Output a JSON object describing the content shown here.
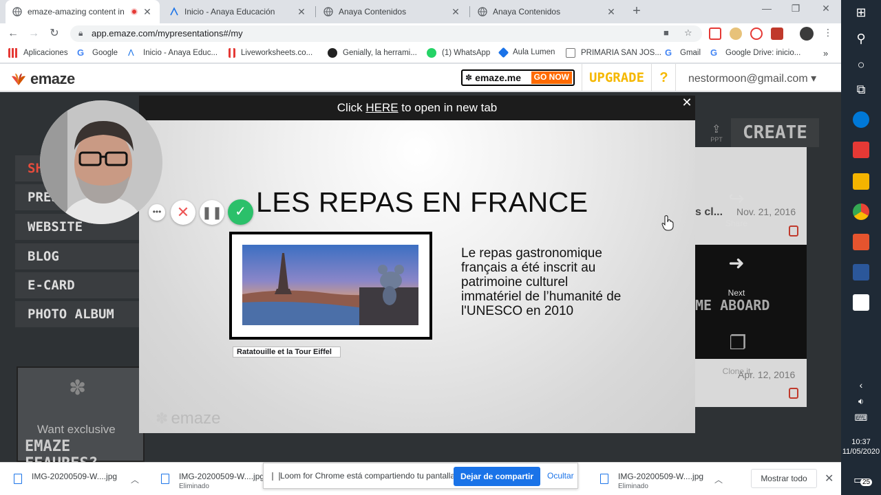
{
  "browser": {
    "tabs": [
      {
        "title": "emaze-amazing content in n",
        "active": true,
        "recording": true
      },
      {
        "title": "Inicio - Anaya Educación"
      },
      {
        "title": "Anaya Contenidos"
      },
      {
        "title": "Anaya Contenidos"
      }
    ],
    "url": "app.emaze.com/mypresentations#/my",
    "bookmarks": [
      "Aplicaciones",
      "Google",
      "Inicio - Anaya Educ...",
      "Liveworksheets.co...",
      "Genially, la herrami...",
      "(1) WhatsApp",
      "Aula Lumen",
      "PRIMARIA SAN JOS...",
      "Gmail",
      "Google Drive: inicio..."
    ]
  },
  "emaze": {
    "logo": "emaze",
    "emazeme_brand": "emaze.me",
    "go_now": "GO NOW",
    "upgrade": "UPGRADE",
    "help": "?",
    "account": "nestormoon@gmail.com ▾",
    "sidebar": [
      "SH",
      "PRES",
      "WEBSITE",
      "BLOG",
      "E-CARD",
      "PHOTO ALBUM"
    ],
    "promo": {
      "line1": "Want exclusive",
      "line2": "EMAZE FEAURES?"
    },
    "create": "CREATE",
    "ppt": "PPT",
    "cards": {
      "title_partial": "s cl...",
      "date1": "Nov. 21, 2016",
      "date2": "Apr. 12, 2016",
      "share": "Share",
      "next": "Next",
      "clone": "Clone it",
      "aboard": "ME ABOARD"
    }
  },
  "modal": {
    "bar_prefix": "Click ",
    "bar_link": "HERE",
    "bar_suffix": " to open in new tab",
    "slide_title": "LES REPAS EN FRANCE",
    "caption": "Ratatouille et la Tour Eiffel",
    "body": "Le repas gastronomique français a été inscrit au patrimoine culturel immatériel de l’humanité de l'UNESCO en 2010",
    "watermark": "emaze"
  },
  "downloads": {
    "items": [
      {
        "name": "IMG-20200509-W....jpg",
        "status": ""
      },
      {
        "name": "IMG-20200509-W....jpg",
        "status": "Eliminado"
      },
      {
        "name": "IMG-20200509-W....jpg",
        "status": "Eliminado"
      }
    ],
    "loom_msg": "Loom for Chrome está compartiendo tu pantalla.",
    "stop_sharing": "Dejar de compartir",
    "hide": "Ocultar",
    "show_all": "Mostrar todo"
  },
  "taskbar": {
    "time": "10:37",
    "date": "11/05/2020",
    "notifications": "25"
  },
  "colors": {
    "emaze_orange": "#ff6a00",
    "upgrade_gold": "#f5b800",
    "loom_green": "#2bc06a",
    "chrome_blue": "#1a73e8"
  }
}
